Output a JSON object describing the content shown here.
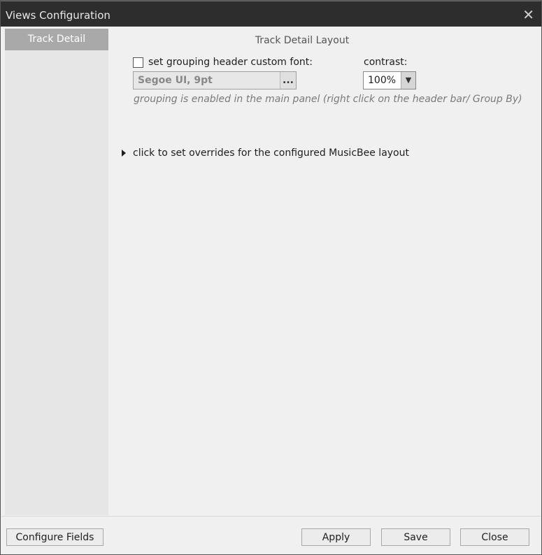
{
  "window": {
    "title": "Views Configuration",
    "close_glyph": "✕"
  },
  "sidebar": {
    "items": [
      {
        "label": "Track Detail",
        "selected": true
      }
    ]
  },
  "content": {
    "heading": "Track Detail Layout",
    "grouping_font": {
      "checkbox_label": "set grouping header custom font:",
      "checked": false,
      "value": "Segoe UI, 9pt",
      "browse_label": "..."
    },
    "contrast": {
      "label": "contrast:",
      "value": "100%",
      "arrow": "▼"
    },
    "hint": "grouping is enabled in the main panel (right click on the header bar/ Group By)",
    "overrides_label": "click to set overrides for the configured MusicBee layout"
  },
  "footer": {
    "configure_fields": "Configure Fields",
    "apply": "Apply",
    "save": "Save",
    "close": "Close"
  }
}
